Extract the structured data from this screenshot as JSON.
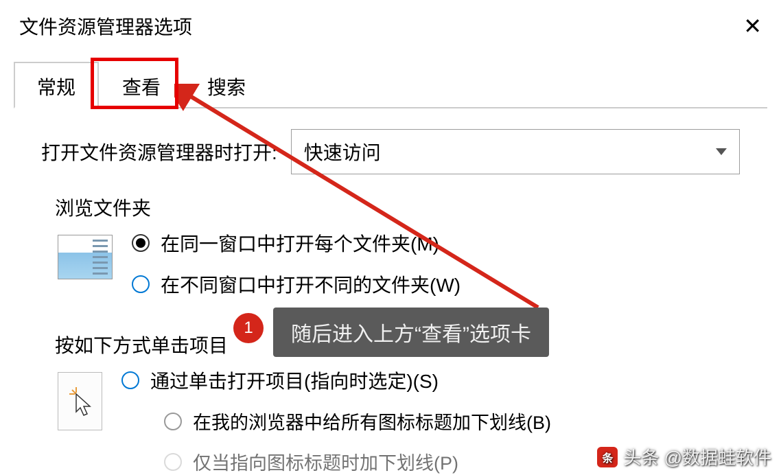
{
  "window": {
    "title": "文件资源管理器选项"
  },
  "tabs": {
    "general": "常规",
    "view": "查看",
    "search": "搜索"
  },
  "general": {
    "open_label": "打开文件资源管理器时打开:",
    "open_value": "快速访问",
    "browse_folders": {
      "legend": "浏览文件夹",
      "same_window": "在同一窗口中打开每个文件夹(M)",
      "diff_window": "在不同窗口中打开不同的文件夹(W)"
    },
    "click_items": {
      "legend": "按如下方式单击项目",
      "single_click": "通过单击打开项目(指向时选定)(S)",
      "underline_all": "在我的浏览器中给所有图标标题加下划线(B)",
      "underline_point": "仅当指向图标标题时加下划线(P)"
    }
  },
  "annotation": {
    "step": "1",
    "tooltip": "随后进入上方“查看”选项卡"
  },
  "watermark": "头条 @数据蛙软件"
}
